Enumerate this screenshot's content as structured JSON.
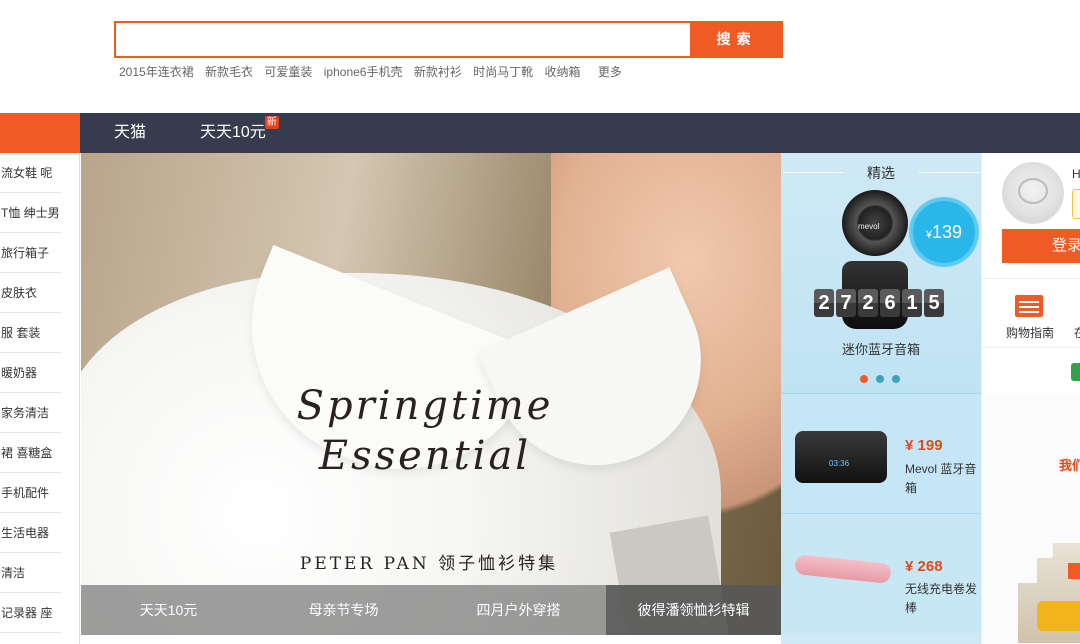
{
  "search": {
    "placeholder": "",
    "button_label": "搜索",
    "hot_words": [
      "2015年连衣裙",
      "新款毛衣",
      "可爱童装",
      "iphone6手机壳",
      "新款衬衫",
      "时尚马丁靴",
      "收纳箱"
    ],
    "more_label": "更多"
  },
  "nav": {
    "items": [
      {
        "label": "天猫"
      },
      {
        "label": "天天10元",
        "badge": "新"
      }
    ]
  },
  "categories": [
    "流女鞋 呢",
    "T恤 绅士男",
    "旅行箱子",
    "皮肤衣",
    "服 套装",
    "暖奶器",
    "家务清洁",
    "裙 喜糖盒",
    "手机配件",
    "生活电器",
    "清洁",
    "记录器 座"
  ],
  "banner": {
    "title_line1": "Springtime",
    "title_line2": "Essential",
    "subtitle": "PETER PAN 领子恤衫特集",
    "tabs": [
      "天天10元",
      "母亲节专场",
      "四月户外穿搭",
      "彼得潘领恤衫特辑"
    ],
    "active_tab": 3
  },
  "featured": {
    "title": "精选",
    "price_symbol": "¥",
    "price": "139",
    "speaker_brand": "mevol",
    "countdown": [
      "2",
      "7",
      "2",
      "6",
      "1",
      "5"
    ],
    "name": "迷你蓝牙音箱",
    "dots": 3,
    "active_dot": 0,
    "products": [
      {
        "price": "¥ 199",
        "name": "Mevol 蓝牙音箱",
        "screen": "03:36"
      },
      {
        "price": "¥ 268",
        "name": "无线充电卷发棒"
      }
    ]
  },
  "user": {
    "greeting": "H",
    "login_label": "登录",
    "guide_label": "购物指南",
    "guide_more": "在",
    "promo_text": "我们"
  },
  "colors": {
    "accent": "#f05a24",
    "nav_bg": "#363c4e",
    "featured_bg": "#cfe9f5",
    "price": "#e24a1a"
  }
}
